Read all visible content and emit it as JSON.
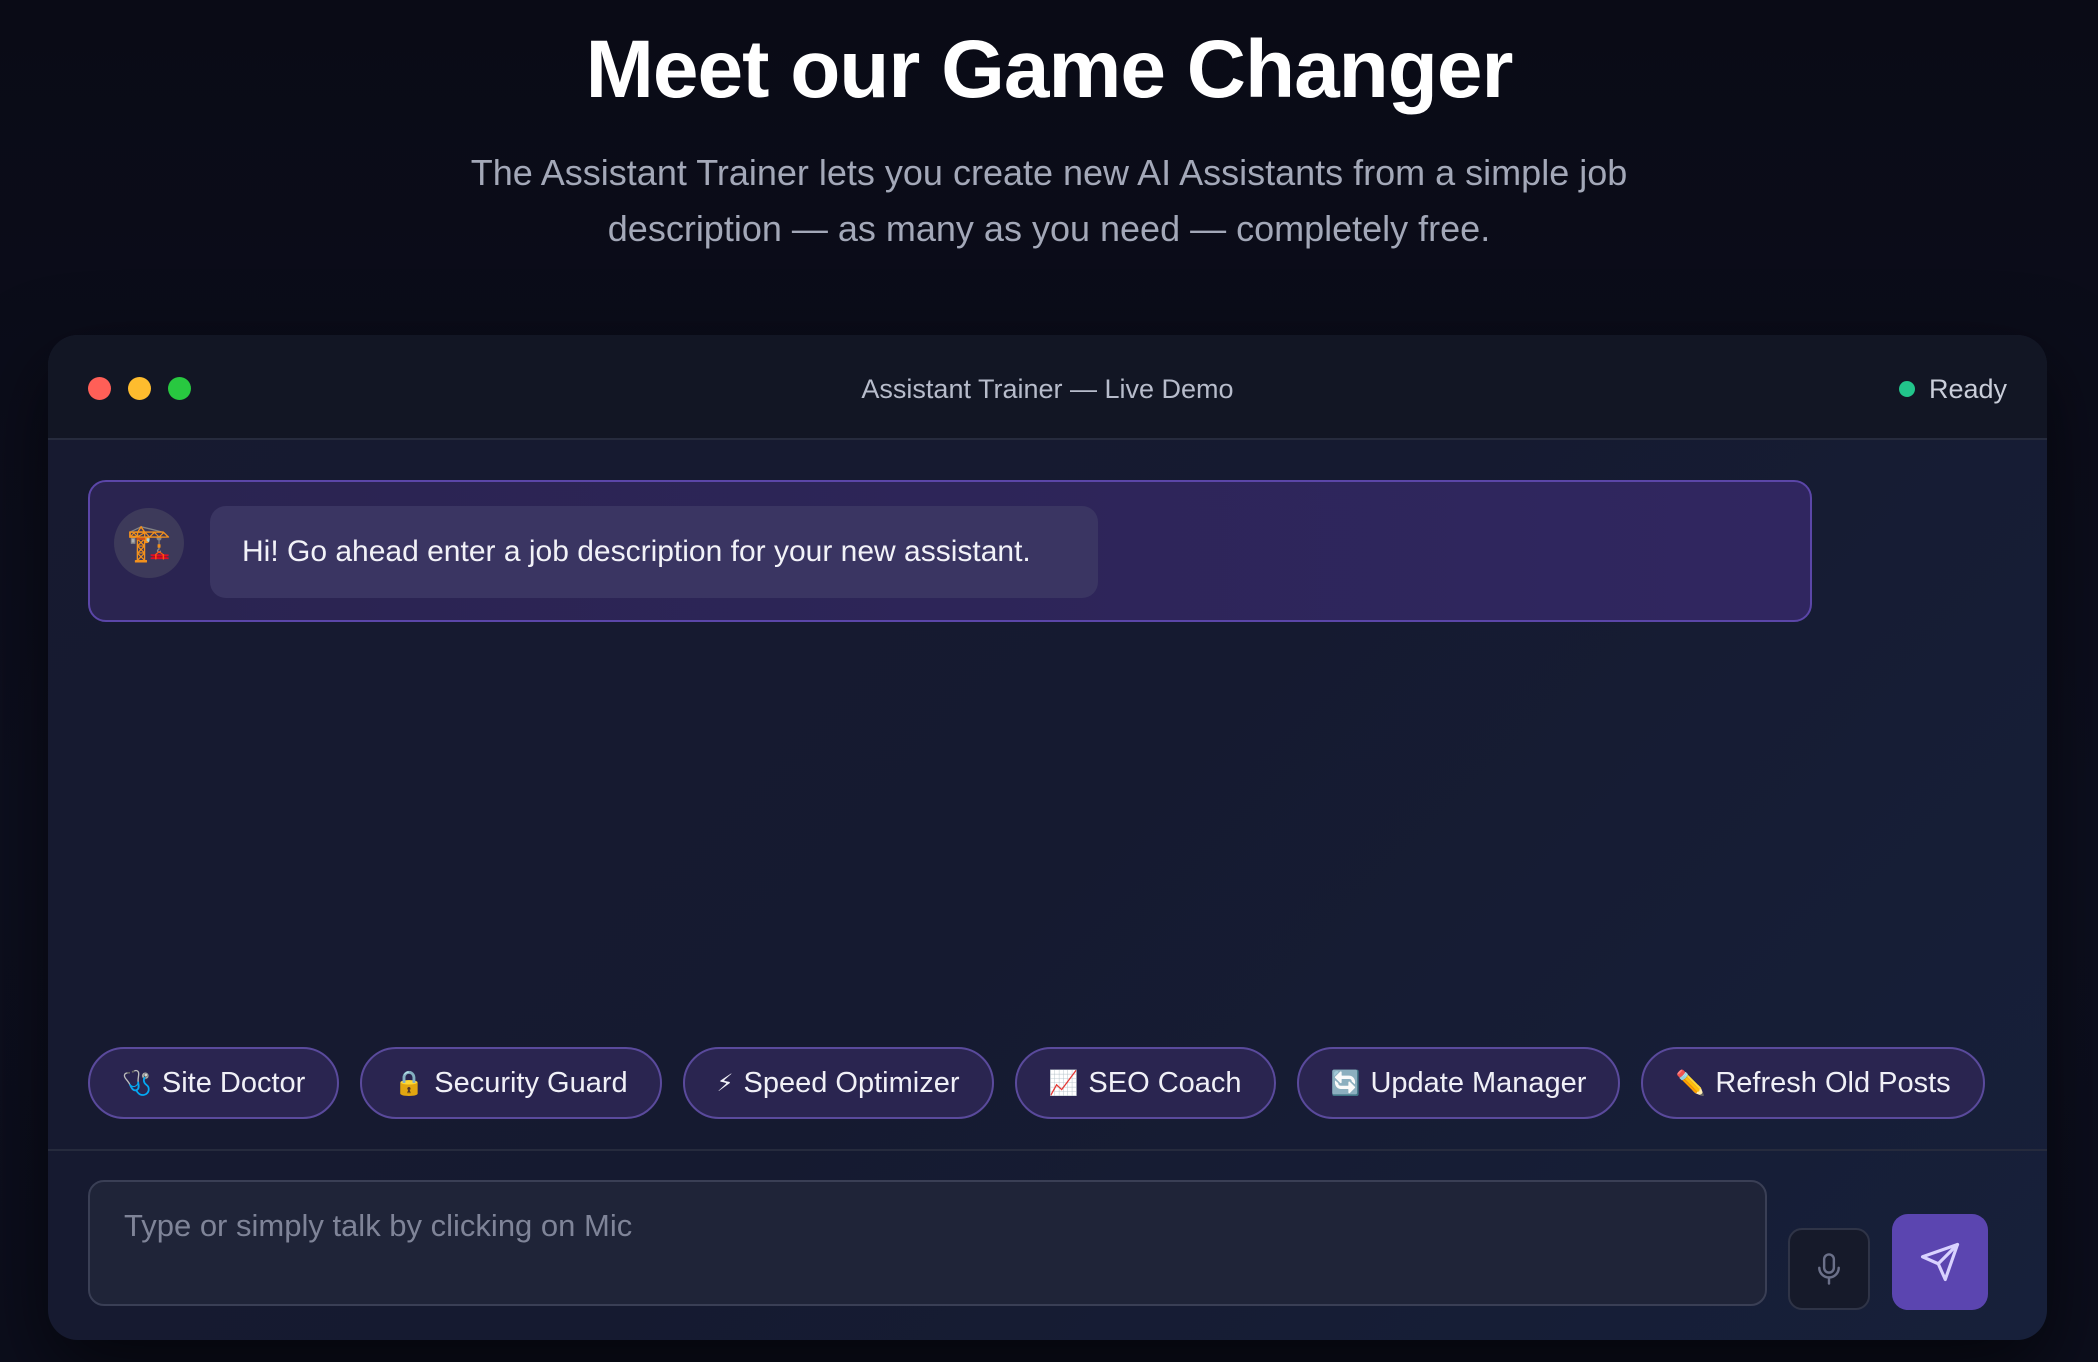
{
  "hero": {
    "title": "Meet our Game Changer",
    "subtitle_line1": "The Assistant Trainer lets you create new AI Assistants from a simple job",
    "subtitle_line2": "description — as many as you need — completely free."
  },
  "window": {
    "title": "Assistant Trainer — Live Demo",
    "status": "Ready",
    "status_color": "#22c58b",
    "traffic_lights": [
      "#ff5f57",
      "#febc2e",
      "#28c840"
    ]
  },
  "chat": {
    "avatar_icon": "construction-crane-icon",
    "avatar_glyph": "🏗️",
    "message": "Hi! Go ahead enter a job description for your new assistant."
  },
  "chips": [
    {
      "icon": "stethoscope-icon",
      "glyph": "🩺",
      "label": "Site Doctor"
    },
    {
      "icon": "lock-icon",
      "glyph": "🔒",
      "label": "Security Guard"
    },
    {
      "icon": "lightning-icon",
      "glyph": "⚡",
      "label": "Speed Optimizer"
    },
    {
      "icon": "chart-icon",
      "glyph": "📈",
      "label": "SEO Coach"
    },
    {
      "icon": "refresh-icon",
      "glyph": "🔄",
      "label": "Update Manager"
    },
    {
      "icon": "pencil-icon",
      "glyph": "✏️",
      "label": "Refresh Old Posts"
    }
  ],
  "composer": {
    "placeholder": "Type or simply talk by clicking on Mic",
    "value": "",
    "mic_icon": "microphone-icon",
    "send_icon": "send-icon",
    "accent": "#5b45b0"
  }
}
